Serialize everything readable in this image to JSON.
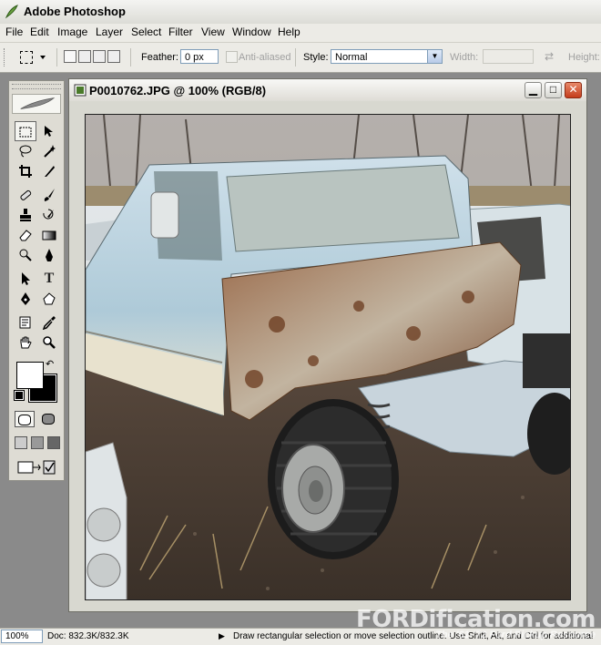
{
  "app": {
    "title": "Adobe Photoshop"
  },
  "menu": [
    "File",
    "Edit",
    "Image",
    "Layer",
    "Select",
    "Filter",
    "View",
    "Window",
    "Help"
  ],
  "options": {
    "feather_label": "Feather:",
    "feather_value": "0 px",
    "antialiased_label": "Anti-aliased",
    "style_label": "Style:",
    "style_value": "Normal",
    "width_label": "Width:",
    "height_label": "Height:"
  },
  "document": {
    "title": "P0010762.JPG @ 100% (RGB/8)"
  },
  "status": {
    "zoom": "100%",
    "doc_size": "Doc: 832.3K/832.3K",
    "hint": "Draw rectangular selection or move selection outline. Use Shift, Alt, and Ctrl for additional"
  },
  "watermark": {
    "brand": "FORDification.com",
    "tagline": "The '61-'72 Ford Pickup Resource"
  },
  "colors": {
    "foreground": "#ffffff",
    "background": "#000000"
  },
  "icons": [
    "marquee-icon",
    "move-icon",
    "lasso-icon",
    "magic-wand-icon",
    "crop-icon",
    "slice-icon",
    "healing-icon",
    "brush-icon",
    "stamp-icon",
    "history-brush-icon",
    "eraser-icon",
    "gradient-icon",
    "dodge-icon",
    "sharpen-icon",
    "path-select-icon",
    "type-icon",
    "pen-icon",
    "shape-icon",
    "notes-icon",
    "eyedropper-icon",
    "hand-icon",
    "zoom-icon"
  ]
}
